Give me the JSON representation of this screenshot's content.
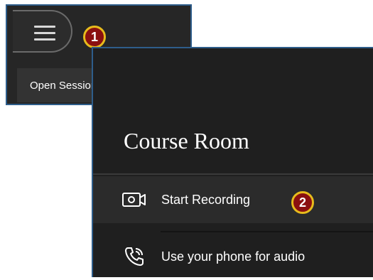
{
  "session_menu": {
    "tooltip": "Open Session menu",
    "badge_1": "1"
  },
  "room": {
    "title": "Course Room",
    "items": [
      {
        "label": "Start Recording",
        "icon": "camera-icon",
        "badge": "2"
      },
      {
        "label": "Use your phone for audio",
        "icon": "phone-icon"
      }
    ]
  },
  "colors": {
    "panel_border": "#2e5d8a",
    "badge_fill": "#8a1010",
    "badge_ring": "#e7bb1c"
  }
}
